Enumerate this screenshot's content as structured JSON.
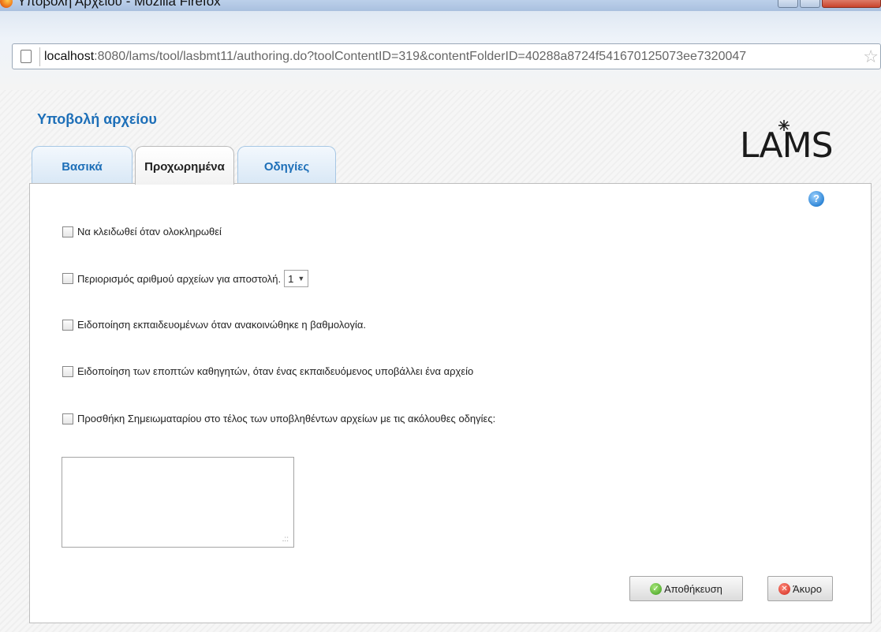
{
  "window": {
    "title": "Υποβολή Αρχείου - Mozilla Firefox"
  },
  "address_bar": {
    "host": "localhost",
    "path": ":8080/lams/tool/lasbmt11/authoring.do?toolContentID=319&contentFolderID=40288a8724f541670125073ee7320047"
  },
  "page": {
    "title": "Υποβολή αρχείου",
    "logo_text": "LAMS",
    "help_label": "?"
  },
  "tabs": [
    {
      "label": "Βασικά",
      "active": false
    },
    {
      "label": "Προχωρημένα",
      "active": true
    },
    {
      "label": "Οδηγίες",
      "active": false
    }
  ],
  "options": {
    "lock_on_finish": "Να κλειδωθεί όταν ολοκληρωθεί",
    "limit_files": "Περιορισμός αριθμού αρχείων για αποστολή.",
    "limit_files_value": "1",
    "notify_learners": "Ειδοποίηση εκπαιδευομένων όταν ανακοινώθηκε η βαθμολογία.",
    "notify_teachers": "Ειδοποίηση των εποπτών καθηγητών, όταν ένας εκπαιδευόμενος υποβάλλει ένα αρχείο",
    "add_notebook": "Προσθήκη Σημειωματαρίου στο τέλος των υποβληθέντων αρχείων με τις ακόλουθες οδηγίες:"
  },
  "buttons": {
    "save": "Αποθήκευση",
    "cancel": "Άκυρο"
  },
  "colors": {
    "accent": "#1d6fb8"
  }
}
